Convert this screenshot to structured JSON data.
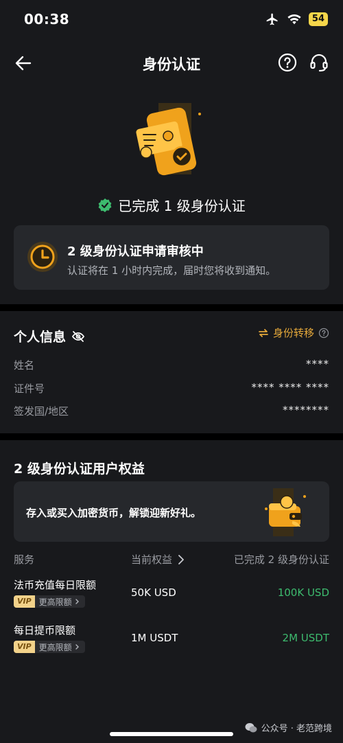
{
  "status": {
    "time": "00:38",
    "battery": "54"
  },
  "nav": {
    "title": "身份认证"
  },
  "level_done": "已完成 1 级身份认证",
  "review": {
    "title": "2 级身份认证申请审核中",
    "subtitle": "认证将在 1 小时内完成，届时您将收到通知。"
  },
  "personal": {
    "title": "个人信息",
    "transfer_label": "身份转移",
    "rows": [
      {
        "label": "姓名",
        "value": "****"
      },
      {
        "label": "证件号",
        "value": "**** **** ****"
      },
      {
        "label": "签发国/地区",
        "value": "********"
      }
    ]
  },
  "benefits": {
    "title": "2 级身份认证用户权益",
    "promo": "存入或买入加密货币，解锁迎新好礼。",
    "headers": {
      "service": "服务",
      "current": "当前权益",
      "level2": "已完成 2 级身份认证"
    },
    "rows": [
      {
        "name": "法币充值每日限额",
        "vip": "VIP",
        "more": "更高限额",
        "current": "50K USD",
        "level2": "100K USD"
      },
      {
        "name": "每日提币限额",
        "vip": "VIP",
        "more": "更高限额",
        "current": "1M USDT",
        "level2": "2M USDT"
      }
    ]
  },
  "watermark": "公众号 · 老范跨境",
  "colors": {
    "background": "#18191c",
    "card": "#26282c",
    "accent_gold": "#e6a93a",
    "success_green": "#3dbb6e"
  }
}
